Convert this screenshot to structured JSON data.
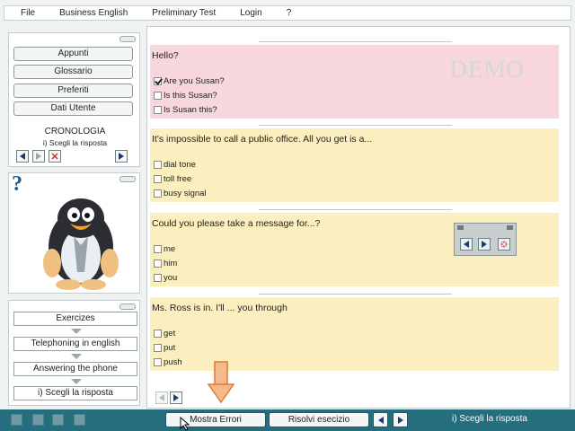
{
  "menu": [
    "File",
    "Business English",
    "Preliminary Test",
    "Login",
    "?"
  ],
  "sidebar": {
    "buttons": [
      "Appunti",
      "Glossario",
      "Preferiti",
      "Dati Utente"
    ],
    "history_title": "CRONOLOGIA",
    "history_item": "i) Scegli la risposta",
    "help_icon": "?",
    "breadcrumb": [
      "Exercizes",
      "Telephoning in english",
      "Answering the phone",
      "i) Scegli la risposta"
    ]
  },
  "watermark": "DEMO",
  "questions": [
    {
      "text": "Hello?",
      "options": [
        "Are you Susan?",
        "Is this Susan?",
        "Is Susan this?"
      ],
      "checked": 0
    },
    {
      "text": "It's impossible to call a public office. All you get is a...",
      "options": [
        "dial tone",
        "toll free",
        "busy signal"
      ],
      "checked": -1
    },
    {
      "text": "Could you please take a message for...?",
      "options": [
        "me",
        "him",
        "you"
      ],
      "checked": -1
    },
    {
      "text": "Ms. Ross is in. I'll ... you through",
      "options": [
        "get",
        "put",
        "push"
      ],
      "checked": -1
    }
  ],
  "bottombar": {
    "show_errors": "Mostra Errori",
    "solve": "Risolvi esecizio",
    "status": "i) Scegli la risposta"
  },
  "colors": {
    "accent": "#256e7d",
    "pink": "#f8d7dc",
    "yellow": "#fbefbf",
    "arrow": "#f0a060"
  }
}
